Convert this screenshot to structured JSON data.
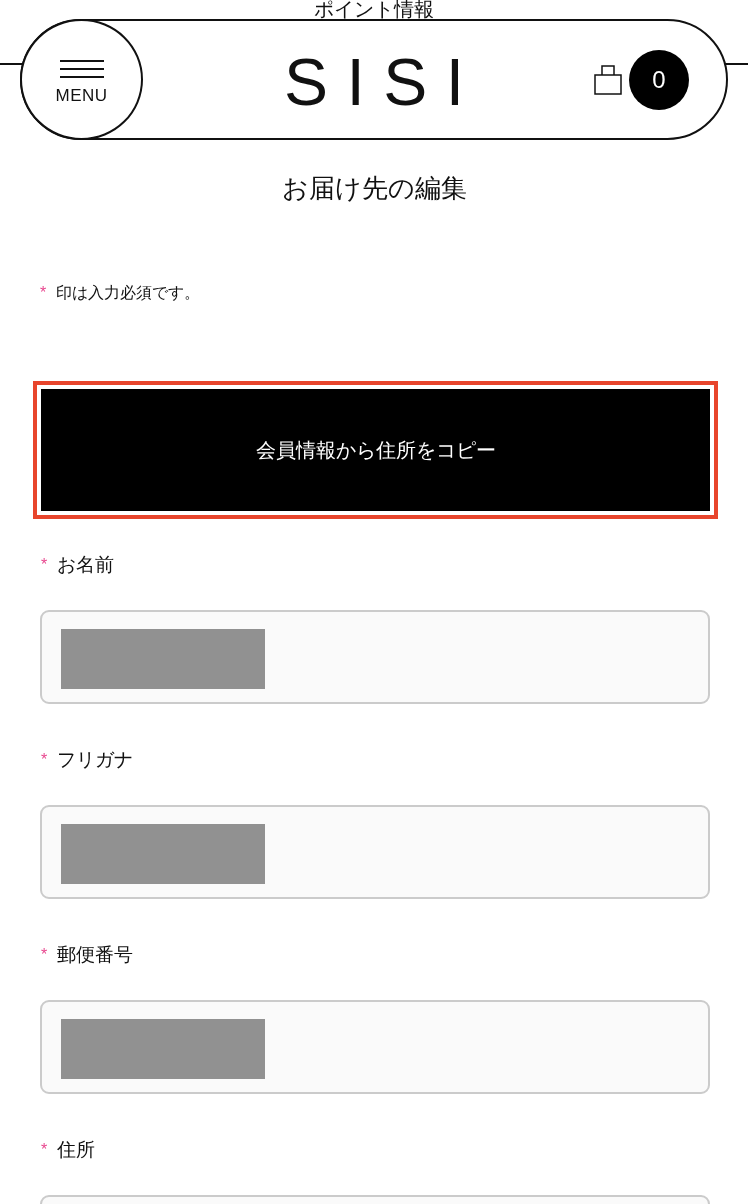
{
  "top_text": "ポイント情報",
  "header": {
    "menu_label": "MENU",
    "logo": "SISI",
    "cart_count": "0"
  },
  "page_title": "お届け先の編集",
  "required_note": {
    "mark": "*",
    "text": "印は入力必須です。"
  },
  "copy_button": {
    "label": "会員情報から住所をコピー",
    "focused": true
  },
  "fields": [
    {
      "mark": "*",
      "label": "お名前",
      "value_redacted": true
    },
    {
      "mark": "*",
      "label": "フリガナ",
      "value_redacted": true
    },
    {
      "mark": "*",
      "label": "郵便番号",
      "value_redacted": true
    },
    {
      "mark": "*",
      "label": "住所",
      "value_redacted": false
    }
  ]
}
